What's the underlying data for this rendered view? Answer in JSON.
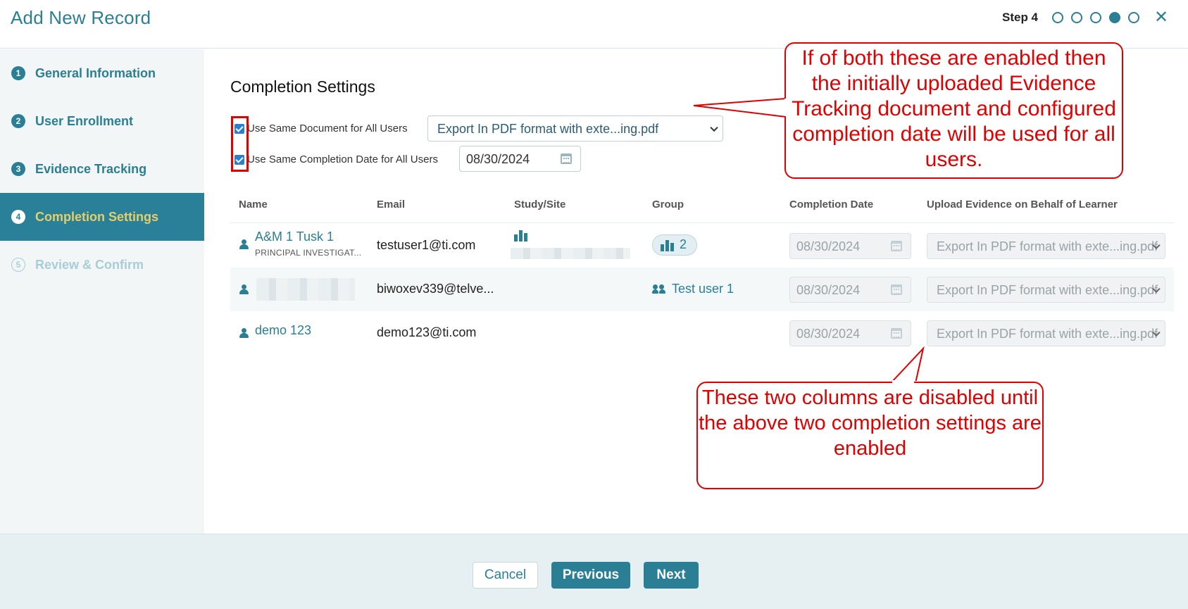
{
  "header": {
    "title": "Add New Record",
    "step_label": "Step 4",
    "close_symbol": "✕",
    "step_dots": [
      false,
      false,
      false,
      true,
      false
    ]
  },
  "sidebar": {
    "items": [
      {
        "num": "1",
        "label": "General Information",
        "state": "done"
      },
      {
        "num": "2",
        "label": "User Enrollment",
        "state": "done"
      },
      {
        "num": "3",
        "label": "Evidence Tracking",
        "state": "done"
      },
      {
        "num": "4",
        "label": "Completion Settings",
        "state": "active"
      },
      {
        "num": "5",
        "label": "Review & Confirm",
        "state": "pending"
      }
    ]
  },
  "main": {
    "section_title": "Completion Settings",
    "same_document": {
      "label": "Use Same Document for All Users",
      "checked": true,
      "selected_value": "Export In PDF format with exte...ing.pdf"
    },
    "same_date": {
      "label": "Use Same Completion Date for All Users",
      "checked": true,
      "value": "08/30/2024"
    }
  },
  "table": {
    "headers": [
      "Name",
      "Email",
      "Study/Site",
      "Group",
      "Completion Date",
      "Upload Evidence on Behalf of Learner"
    ],
    "rows": [
      {
        "name": "A&M 1 Tusk 1",
        "role": "PRINCIPAL INVESTIGAT...",
        "email": "testuser1@ti.com",
        "group": "2",
        "completion_date": "08/30/2024",
        "evidence": "Export In PDF format with exte...ing.pdf"
      },
      {
        "name": "",
        "role": "",
        "email": "biwoxev339@telve...",
        "group": "Test user 1",
        "completion_date": "08/30/2024",
        "evidence": "Export In PDF format with exte...ing.pdf"
      },
      {
        "name": "demo 123",
        "role": "",
        "email": "demo123@ti.com",
        "group": "",
        "completion_date": "08/30/2024",
        "evidence": "Export In PDF format with exte...ing.pdf"
      }
    ]
  },
  "callouts": {
    "top": "If of both these are enabled then the initially uploaded Evidence Tracking document and configured completion date will be used for all users.",
    "bottom": "These two columns are disabled until the above two completion settings are enabled"
  },
  "footer": {
    "cancel_label": "Cancel",
    "previous_label": "Previous",
    "next_label": "Next"
  },
  "colors": {
    "primary": "#2a7f94",
    "active_step_text": "#e3cf6a",
    "annotation_red": "#e00000"
  }
}
